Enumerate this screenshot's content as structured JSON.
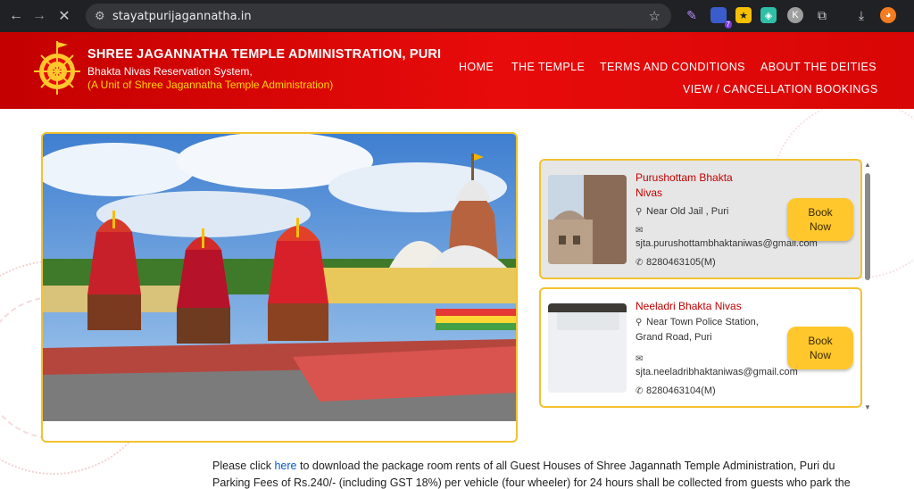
{
  "browser": {
    "url": "stayatpurijagannatha.in",
    "extension_badge": "7"
  },
  "header": {
    "title": "SHREE JAGANNATHA TEMPLE ADMINISTRATION, PURI",
    "subtitle": "Bhakta Nivas Reservation System,",
    "unit": "(A Unit of Shree Jagannatha Temple Administration)",
    "nav": {
      "home": "HOME",
      "temple": "THE TEMPLE",
      "terms": "TERMS AND CONDITIONS",
      "deities": "ABOUT THE DEITIES",
      "bookings": "VIEW / CANCELLATION BOOKINGS"
    }
  },
  "cards": [
    {
      "name_line1": "Purushottam Bhakta",
      "name_line2": "Nivas",
      "address1": "Near Old Jail , Puri",
      "email": "sjta.purushottambhaktaniwas@gmail.com",
      "phone": "8280463105(M)",
      "book_line1": "Book",
      "book_line2": "Now"
    },
    {
      "name_line1": "Neeladri Bhakta Nivas",
      "address1": "Near Town Police Station,",
      "address2": "Grand Road, Puri",
      "email": "sjta.neeladribhaktaniwas@gmail.com",
      "phone": "8280463104(M)",
      "book_line1": "Book",
      "book_line2": "Now"
    }
  ],
  "notice": {
    "line1_pre": "Please click ",
    "line1_link": "here",
    "line1_post": " to download the package room rents of all Guest Houses of Shree Jagannath Temple Administration, Puri du",
    "line2": "Parking Fees of Rs.240/- (including GST 18%) per vehicle (four wheeler) for 24 hours shall be collected from guests who park the"
  },
  "colors": {
    "header_red": "#e00a0a",
    "accent_yellow": "#ffc72c",
    "card_title_red": "#c40000",
    "unit_yellow": "#ffd400",
    "link_blue": "#0a58ca"
  }
}
